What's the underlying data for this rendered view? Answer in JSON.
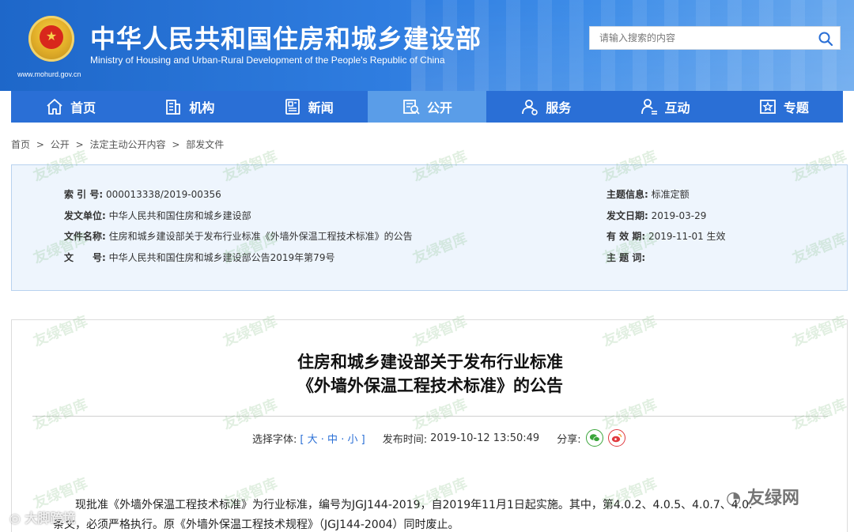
{
  "header": {
    "site_title": "中华人民共和国住房和城乡建设部",
    "site_subtitle": "Ministry of Housing and Urban-Rural Development of the People's Republic of China",
    "site_url": "www.mohurd.gov.cn",
    "search_placeholder": "请输入搜索的内容"
  },
  "nav": {
    "items": [
      {
        "label": "首页",
        "icon": "home-icon"
      },
      {
        "label": "机构",
        "icon": "building-icon"
      },
      {
        "label": "新闻",
        "icon": "news-icon"
      },
      {
        "label": "公开",
        "icon": "disclosure-icon"
      },
      {
        "label": "服务",
        "icon": "service-icon"
      },
      {
        "label": "互动",
        "icon": "interact-icon"
      },
      {
        "label": "专题",
        "icon": "topic-icon"
      }
    ],
    "active_index": 3
  },
  "breadcrumb": [
    "首页",
    ">",
    "公开",
    ">",
    "法定主动公开内容",
    ">",
    "部发文件"
  ],
  "info": {
    "index_label": "索 引 号:",
    "index_value": "000013338/2019-00356",
    "issuer_label": "发文单位:",
    "issuer_value": "中华人民共和国住房和城乡建设部",
    "filename_label": "文件名称:",
    "filename_value": "住房和城乡建设部关于发布行业标准《外墙外保温工程技术标准》的公告",
    "docno_label": "文　　号:",
    "docno_value": "中华人民共和国住房和城乡建设部公告2019年第79号",
    "topic_label": "主题信息:",
    "topic_value": "标准定额",
    "date_label": "发文日期:",
    "date_value": "2019-03-29",
    "validity_label": "有 效 期:",
    "validity_value": "2019-11-01 生效",
    "keywords_label": "主 题 词:",
    "keywords_value": ""
  },
  "article": {
    "title_line1": "住房和城乡建设部关于发布行业标准",
    "title_line2": "《外墙外保温工程技术标准》的公告",
    "font_label": "选择字体:",
    "font_open": "[",
    "font_large": "大",
    "font_sep1": "·",
    "font_medium": "中",
    "font_sep2": "·",
    "font_small": "小",
    "font_close": "]",
    "publish_label": "发布时间:",
    "publish_time": "2019-10-12 13:50:49",
    "share_label": "分享:",
    "body_line1": "现批准《外墙外保温工程技术标准》为行业标准，编号为JGJ144-2019，自2019年11月1日起实施。其中，第4.0.2、4.0.5、4.0.7、4.0.",
    "body_line2": "条文，必须严格执行。原《外墙外保温工程技术规程》（JGJ144-2004）同时废止。"
  },
  "watermarks": {
    "brand": "友绿智库",
    "wechat_brand": "友绿网",
    "weibo_brand": "大脚跨境"
  },
  "colors": {
    "header_blue": "#1e67c9",
    "nav_blue": "#2a6fd6",
    "nav_active": "#5a9de8",
    "info_bg": "#eef5fd"
  }
}
